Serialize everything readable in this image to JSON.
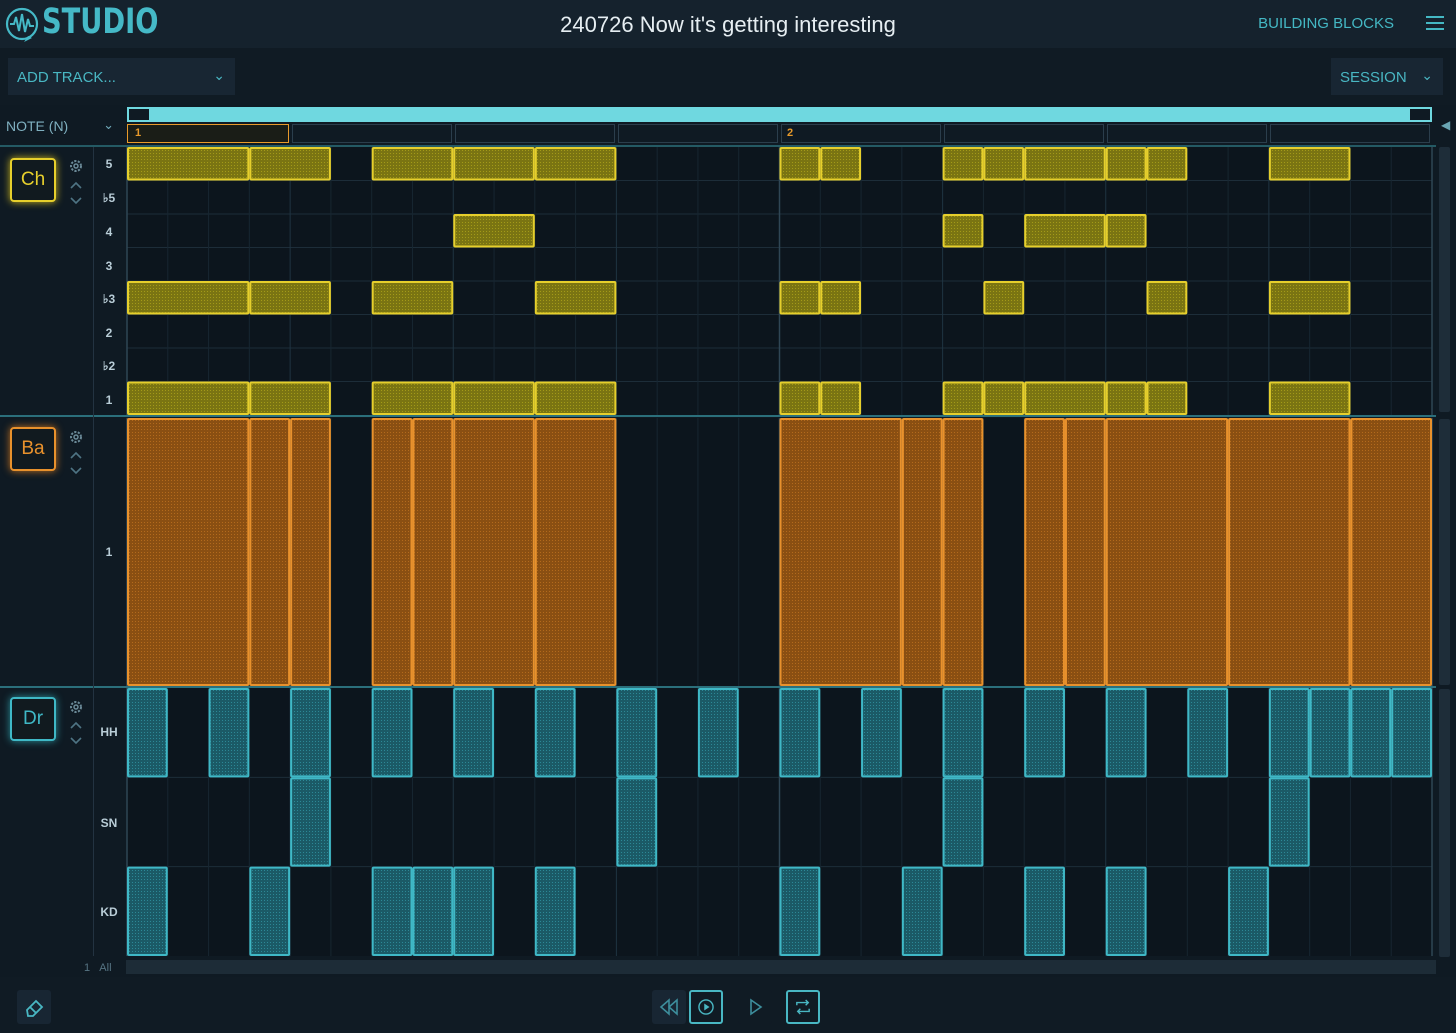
{
  "app": {
    "name": "STUDIO",
    "song_title": "240726 Now it's getting interesting",
    "right_link": "BUILDING BLOCKS"
  },
  "toolbar": {
    "add_track": "ADD TRACK...",
    "session": "SESSION",
    "note_select": "NOTE (N)"
  },
  "ruler": {
    "bars": [
      "1",
      "2"
    ]
  },
  "tracks": [
    {
      "badge": "Ch",
      "color": "#e6cf2c",
      "rows": [
        "5",
        "♭5",
        "4",
        "3",
        "♭3",
        "2",
        "♭2",
        "1"
      ]
    },
    {
      "badge": "Ba",
      "color": "#e8912c",
      "rows": [
        "1"
      ]
    },
    {
      "badge": "Dr",
      "color": "#3fb8c6",
      "rows": [
        "HH",
        "SN",
        "KD"
      ]
    }
  ],
  "footer": {
    "count": "1",
    "all": "All"
  },
  "transport": {
    "icons": [
      "rewind-icon",
      "play-from-icon",
      "play-icon",
      "loop-icon"
    ],
    "eraser": "eraser-icon"
  },
  "notes": {
    "chords": [
      {
        "row": 0,
        "starts": [
          0,
          3,
          6,
          8,
          10,
          16,
          17,
          20,
          21,
          22,
          24,
          25,
          28
        ]
      },
      {
        "row": 2,
        "starts": [
          8,
          20,
          22,
          24
        ]
      },
      {
        "row": 4,
        "starts": [
          0,
          3,
          6,
          10,
          16,
          17,
          21,
          25,
          28
        ]
      },
      {
        "row": 7,
        "starts": [
          0,
          3,
          6,
          8,
          10,
          16,
          17,
          20,
          21,
          22,
          24,
          25,
          28
        ]
      }
    ],
    "chord_lengths": {
      "0": [
        3,
        2,
        2,
        2,
        2,
        1,
        1,
        1,
        1,
        2,
        1,
        1,
        2
      ],
      "2": [
        2,
        1,
        2,
        1
      ],
      "4": [
        3,
        2,
        2,
        2,
        1,
        1,
        1,
        1,
        2
      ],
      "7": [
        3,
        2,
        2,
        2,
        2,
        1,
        1,
        1,
        1,
        2,
        1,
        1,
        2
      ]
    },
    "bass": [
      [
        0,
        3
      ],
      [
        3,
        1
      ],
      [
        4,
        1
      ],
      [
        6,
        1
      ],
      [
        7,
        1
      ],
      [
        8,
        2
      ],
      [
        10,
        2
      ],
      [
        16,
        3
      ],
      [
        19,
        1
      ],
      [
        20,
        1
      ],
      [
        22,
        1
      ],
      [
        23,
        1
      ],
      [
        24,
        3
      ],
      [
        27,
        3
      ],
      [
        30,
        2
      ]
    ],
    "drums": {
      "HH": [
        0,
        2,
        4,
        6,
        8,
        10,
        12,
        14,
        16,
        18,
        20,
        22,
        24,
        26,
        28,
        29,
        30,
        31
      ],
      "SN": [
        4,
        12,
        20,
        28
      ],
      "KD": [
        0,
        3,
        6,
        7,
        8,
        10,
        16,
        19,
        22,
        24,
        27
      ]
    }
  }
}
